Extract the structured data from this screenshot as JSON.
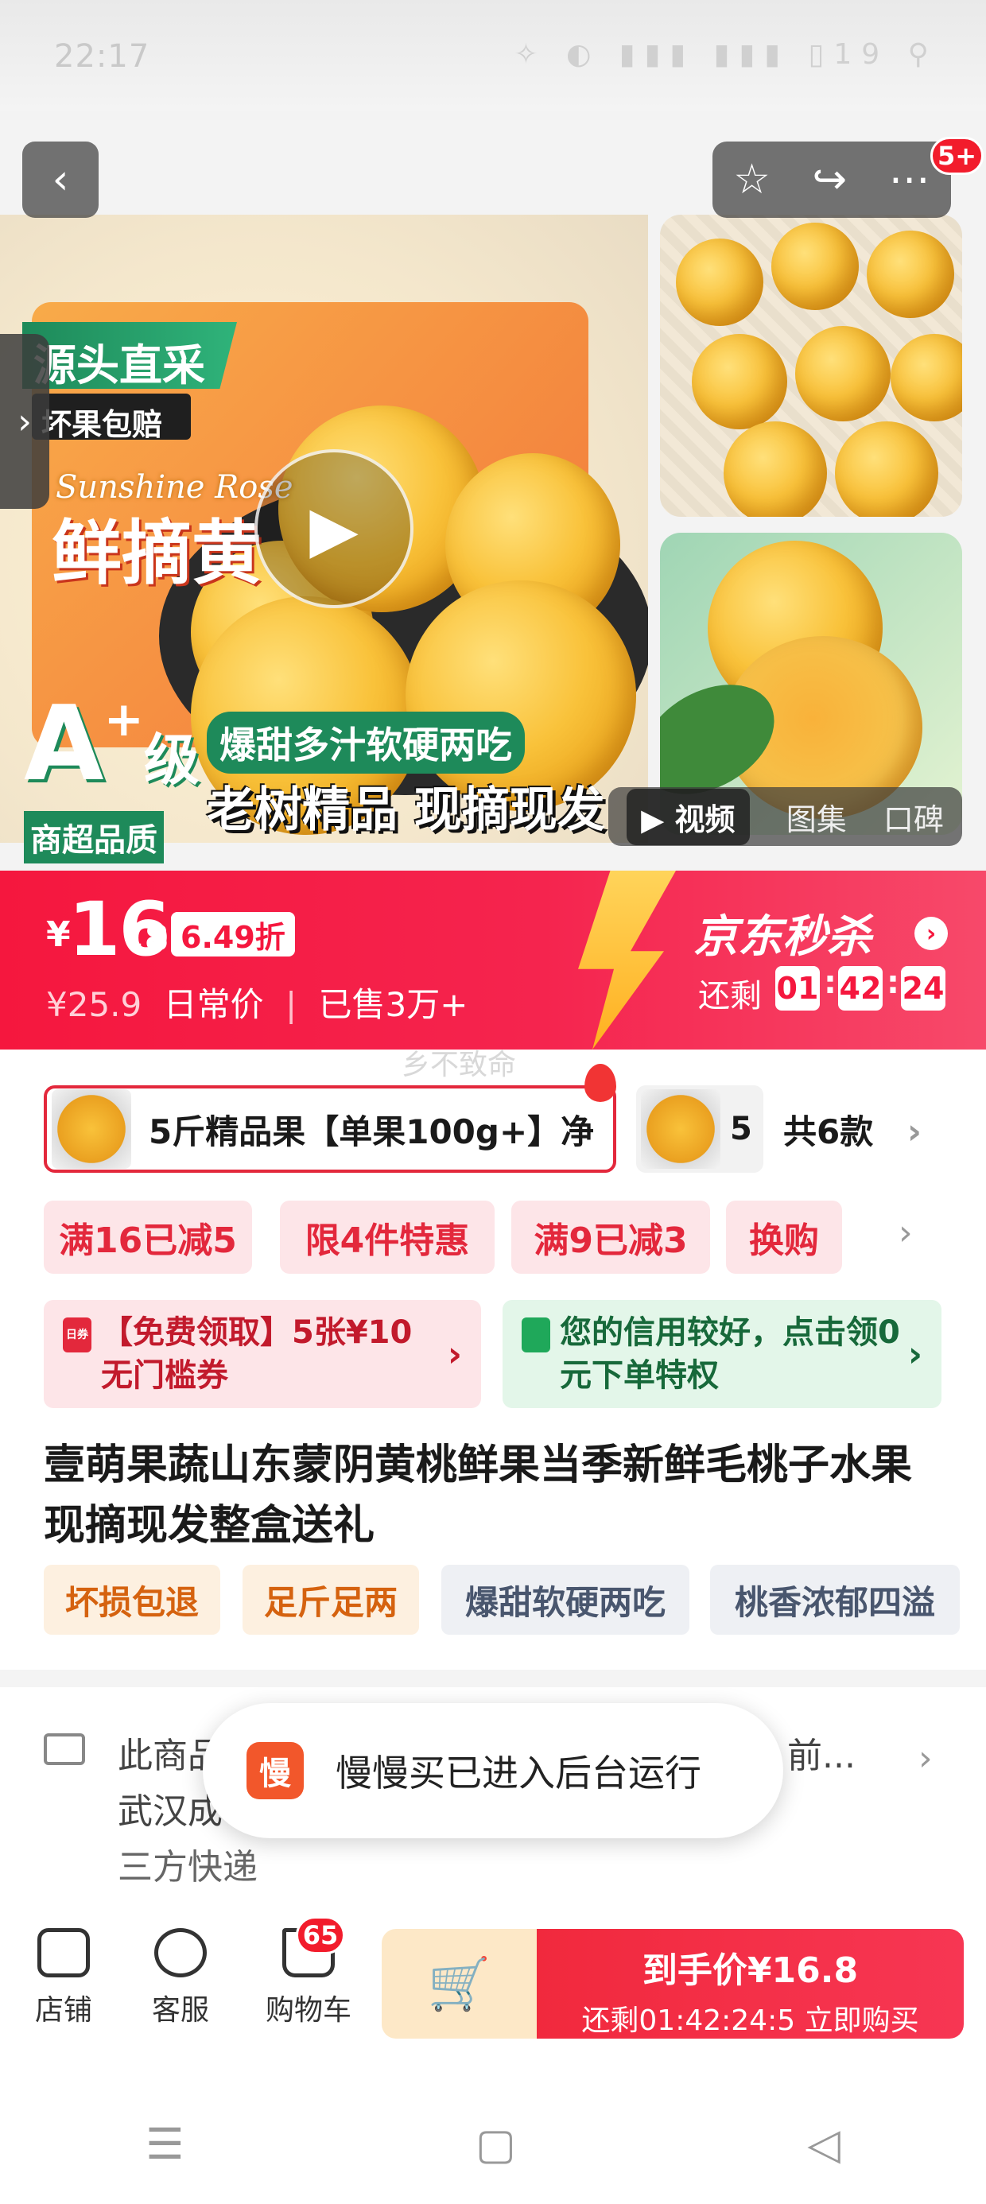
{
  "status_bar": {
    "time": "22:17",
    "icons": "✧ ◐ ▮▮▮ ▮▮▮ ▯19 ⚲"
  },
  "gallery": {
    "badge_count": "5+",
    "main_overlay": {
      "tag_top": "源头直采",
      "tag_bad": "坏果包赔",
      "brand_en": "Sunshine Rose",
      "brand_cn": "鲜摘黄",
      "grade": "A",
      "grade_plus": "+",
      "grade_level": "级",
      "grade_sub": "商超品质",
      "slogan1": "爆甜多汁软硬两吃",
      "slogan2": "老树精品 现摘现发"
    },
    "media_tabs": [
      "视频",
      "图集",
      "口碑"
    ]
  },
  "price": {
    "symbol": "¥",
    "integer": "16",
    "decimal": ".8",
    "discount": "6.49折",
    "original": "¥25.9",
    "original_label": "日常价",
    "divider": "|",
    "sold": "已售3万+",
    "flash_title": "京东秒杀",
    "remain_label": "还剩",
    "countdown": [
      "01",
      "42",
      "24"
    ],
    "colors": {
      "banner": "#f5173e",
      "accent": "#ffd45a"
    }
  },
  "watermark": "乡不致命",
  "sku": {
    "selected": "5斤精品果【单果100g+】净",
    "second": "5",
    "total": "共6款"
  },
  "promos": [
    "满16已减5",
    "限4件特惠",
    "满9已减3",
    "换购"
  ],
  "coupons": [
    {
      "text": "【免费领取】5张¥10无门槛券",
      "icon_label": "日券"
    },
    {
      "text": "您的信用较好，点击领0元下单特权"
    }
  ],
  "title": "壹萌果蔬山东蒙阴黄桃鲜果当季新鲜毛桃子水果现摘现发整盒送礼",
  "tags": [
    "坏损包退",
    "足斤足两",
    "爆甜软硬两吃",
    "桃香浓郁四溢"
  ],
  "shipping": {
    "line1": "此商品",
    "line1_end": "前...",
    "line2": "武汉成",
    "line3": "三方快递"
  },
  "toast": {
    "logo": "慢",
    "message": "慢慢买已进入后台运行"
  },
  "bottom": {
    "shop": "店铺",
    "service": "客服",
    "cart": "购物车",
    "cart_count": "65",
    "buy_price": "到手价¥16.8",
    "buy_sub": "还剩01:42:24:5 立即购买"
  },
  "icons": {
    "back": "back-icon",
    "star": "star-icon",
    "share": "share-icon",
    "more": "more-icon",
    "play": "play-icon",
    "cart_add": "cart-add-icon"
  }
}
